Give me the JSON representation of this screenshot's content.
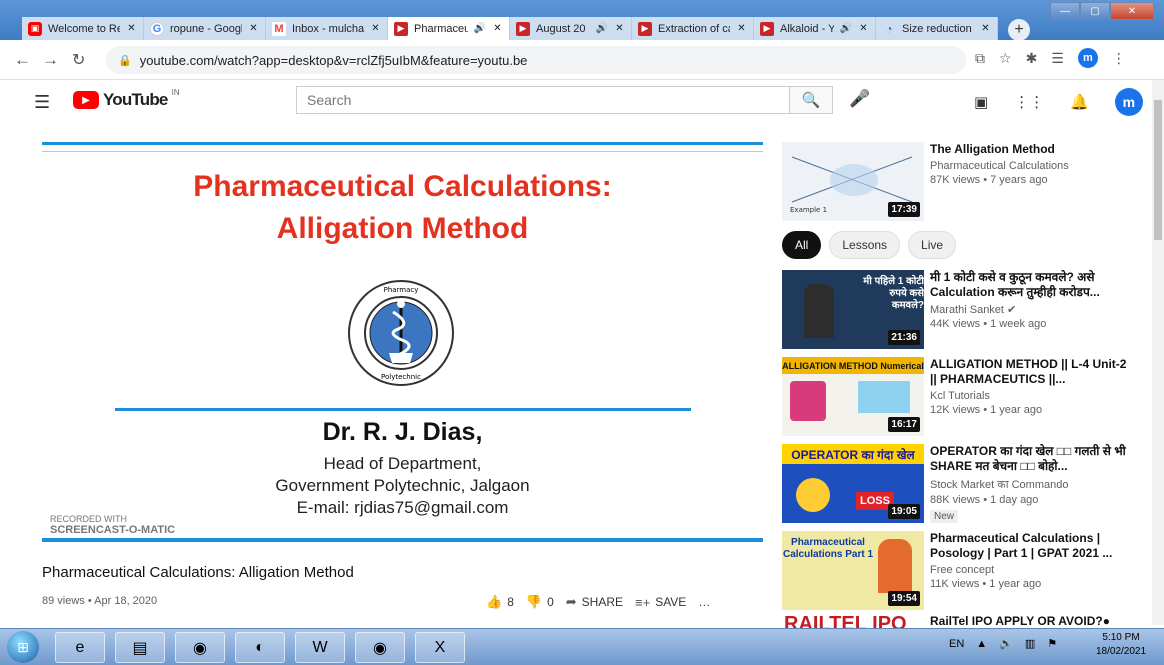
{
  "tabs": [
    {
      "label": "Welcome to Re",
      "icon": "tile-icon",
      "active": false
    },
    {
      "label": "ropune - Googl",
      "icon": "google-icon",
      "active": false
    },
    {
      "label": "Inbox - mulcha",
      "icon": "gmail-icon",
      "active": false
    },
    {
      "label": "Pharmaceu",
      "icon": "youtube-icon",
      "active": true
    },
    {
      "label": "August 20",
      "icon": "youtube-icon",
      "active": false
    },
    {
      "label": "Extraction of ca",
      "icon": "youtube-icon",
      "active": false
    },
    {
      "label": "Alkaloid - Y",
      "icon": "youtube-icon",
      "active": false
    },
    {
      "label": "Size reduction",
      "icon": "loading-icon",
      "active": false
    }
  ],
  "address": {
    "url": "youtube.com/watch?app=desktop&v=rclZfj5uIbM&feature=youtu.be"
  },
  "youtube": {
    "logo": "YouTube",
    "region": "IN",
    "search_placeholder": "Search",
    "avatar": "m"
  },
  "slide": {
    "title_line1": "Pharmaceutical Calculations:",
    "title_line2": "Alligation Method",
    "author": "Dr. R. J. Dias,",
    "role": "Head of Department,",
    "institution": "Government Polytechnic, Jalgaon",
    "email": "E-mail: rjdias75@gmail.com",
    "emblem_top": "Department of Pharmacy",
    "emblem_bottom": "Government Polytechnic Jalgaon",
    "watermark_top": "RECORDED WITH",
    "watermark_bottom": "SCREENCAST-O-MATIC"
  },
  "video": {
    "title": "Pharmaceutical Calculations: Alligation Method",
    "meta": "89 views • Apr 18, 2020",
    "likes": "8",
    "dislikes": "0",
    "share": "SHARE",
    "save": "SAVE",
    "more": "…"
  },
  "chips": [
    "All",
    "Lessons",
    "Live"
  ],
  "related": [
    {
      "title": "The Alligation Method",
      "channel": "Pharmaceutical Calculations",
      "views": "87K views • 7 years ago",
      "duration": "17:39",
      "thumb_color": "#d9e0e8",
      "thumb_label": ""
    },
    {
      "title": "मी 1 कोटी कसे व कुठून कमवले? असे Calculation करून तुम्हीही करोडप...",
      "channel": "Marathi Sanket ✔",
      "views": "44K views • 1 week ago",
      "duration": "21:36",
      "thumb_color": "#203a5c",
      "thumb_label": "मी पहिले 1 कोटी रुपये कसे कमवले?"
    },
    {
      "title": "ALLIGATION METHOD || L-4 Unit-2 || PHARMACEUTICS ||...",
      "channel": "Kcl Tutorials",
      "views": "12K views • 1 year ago",
      "duration": "16:17",
      "thumb_color": "#f3f2ec",
      "thumb_label": "ALLIGATION METHOD Numerical"
    },
    {
      "title": "OPERATOR का गंदा खेल □□ गलती से भी SHARE मत बेचना □□ बोहो...",
      "channel": "Stock Market का Commando",
      "views": "88K views • 1 day ago",
      "duration": "19:05",
      "thumb_color": "#1d4fbf",
      "thumb_label": "OPERATOR का गंदा खेल",
      "badge": "New"
    },
    {
      "title": "Pharmaceutical Calculations | Posology | Part 1 | GPAT 2021 ...",
      "channel": "Free concept",
      "views": "11K views • 1 year ago",
      "duration": "19:54",
      "thumb_color": "#f0e9a4",
      "thumb_label": "Pharmaceutical Calculations Part 1"
    },
    {
      "title": "RailTel IPO APPLY OR AVOID?●",
      "channel": "",
      "views": "",
      "duration": "",
      "thumb_color": "#ffffff",
      "thumb_label": "RAILTEL IPO"
    }
  ],
  "taskbar": {
    "language": "EN",
    "time": "5:10 PM",
    "date": "18/02/2021"
  }
}
